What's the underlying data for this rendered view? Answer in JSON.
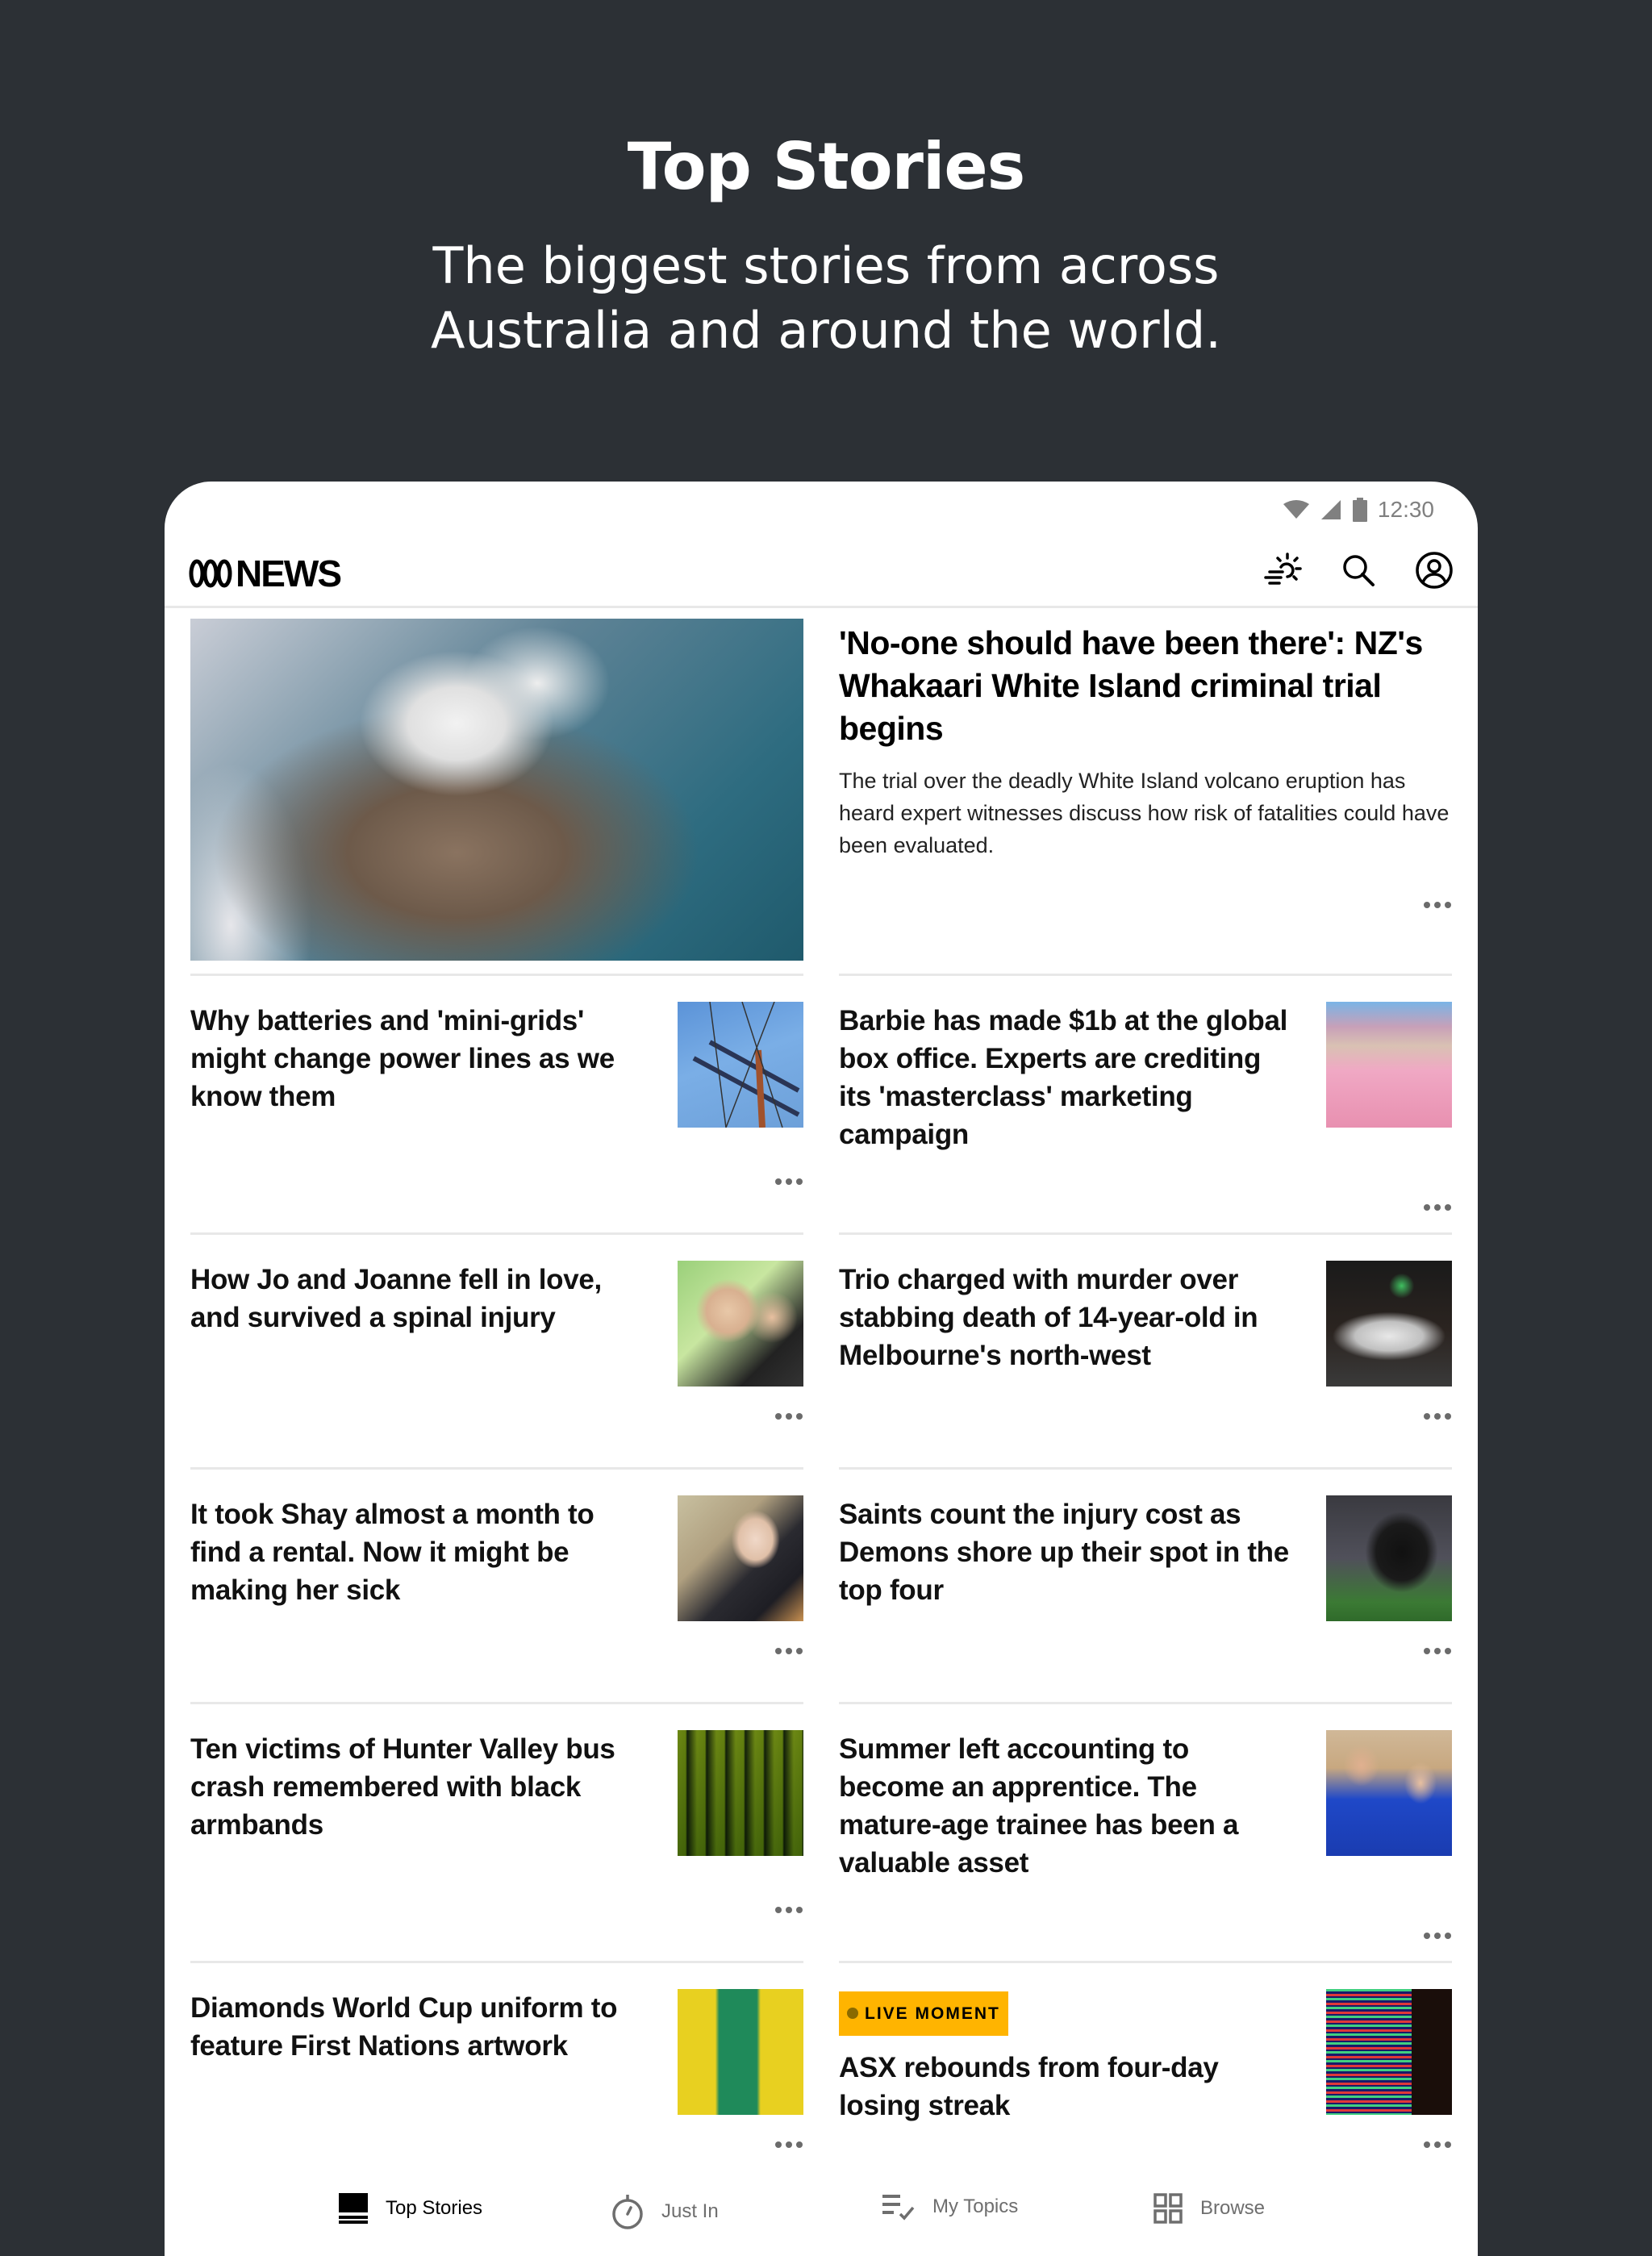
{
  "promo": {
    "title": "Top Stories",
    "subtitle_line1": "The biggest stories from across",
    "subtitle_line2": "Australia and around the world."
  },
  "status_bar": {
    "time": "12:30",
    "icons": [
      "wifi-icon",
      "cell-signal-icon",
      "battery-icon"
    ]
  },
  "app_bar": {
    "logo_text": "NEWS",
    "actions": [
      {
        "name": "weather-icon",
        "label": "Weather"
      },
      {
        "name": "search-icon",
        "label": "Search"
      },
      {
        "name": "account-icon",
        "label": "Account"
      }
    ]
  },
  "hero": {
    "title": "'No-one should have been there': NZ's Whakaari White Island criminal trial begins",
    "description": "The trial over the deadly White Island volcano eruption has heard expert witnesses discuss how risk of fatalities could have been evaluated.",
    "image": "aerial-volcano-island-photo",
    "more": "more-options"
  },
  "stories": [
    {
      "title": "Why batteries and 'mini-grids' might change power lines as we know them",
      "image": "power-lines-photo"
    },
    {
      "title": "Barbie has made $1b at the global box office. Experts are crediting its 'masterclass' marketing campaign",
      "image": "barbie-movie-still"
    },
    {
      "title": "How Jo and Joanne fell in love, and survived a spinal injury",
      "image": "couple-selfie-photo"
    },
    {
      "title": "Trio charged with murder over stabbing death of 14-year-old in Melbourne's north-west",
      "image": "police-car-night-photo"
    },
    {
      "title": "It took Shay almost a month to find a rental. Now it might be making her sick",
      "image": "woman-portrait-photo"
    },
    {
      "title": "Saints count the injury cost as Demons shore up their spot in the top four",
      "image": "injured-afl-player-photo"
    },
    {
      "title": "Ten victims of Hunter Valley bus crash remembered with black armbands",
      "image": "football-team-lineup-photo"
    },
    {
      "title": "Summer left accounting to become an apprentice. The mature-age trainee has been a valuable asset",
      "image": "apprentice-and-boss-photo"
    },
    {
      "title": "Diamonds World Cup uniform to feature First Nations artwork",
      "image": "netball-players-uniform-photo"
    },
    {
      "title": "ASX rebounds from four-day losing streak",
      "image": "stock-ticker-board-photo",
      "badge": "LIVE MOMENT"
    }
  ],
  "colors": {
    "background": "#2c3035",
    "live_badge": "#ffb400",
    "divider": "#e8e8e8"
  },
  "bottom_nav": {
    "items": [
      {
        "label": "Top Stories",
        "icon": "top-stories-icon",
        "active": true
      },
      {
        "label": "Just In",
        "icon": "stopwatch-icon",
        "active": false
      },
      {
        "label": "My Topics",
        "icon": "checklist-icon",
        "active": false
      },
      {
        "label": "Browse",
        "icon": "grid-icon",
        "active": false
      }
    ]
  }
}
